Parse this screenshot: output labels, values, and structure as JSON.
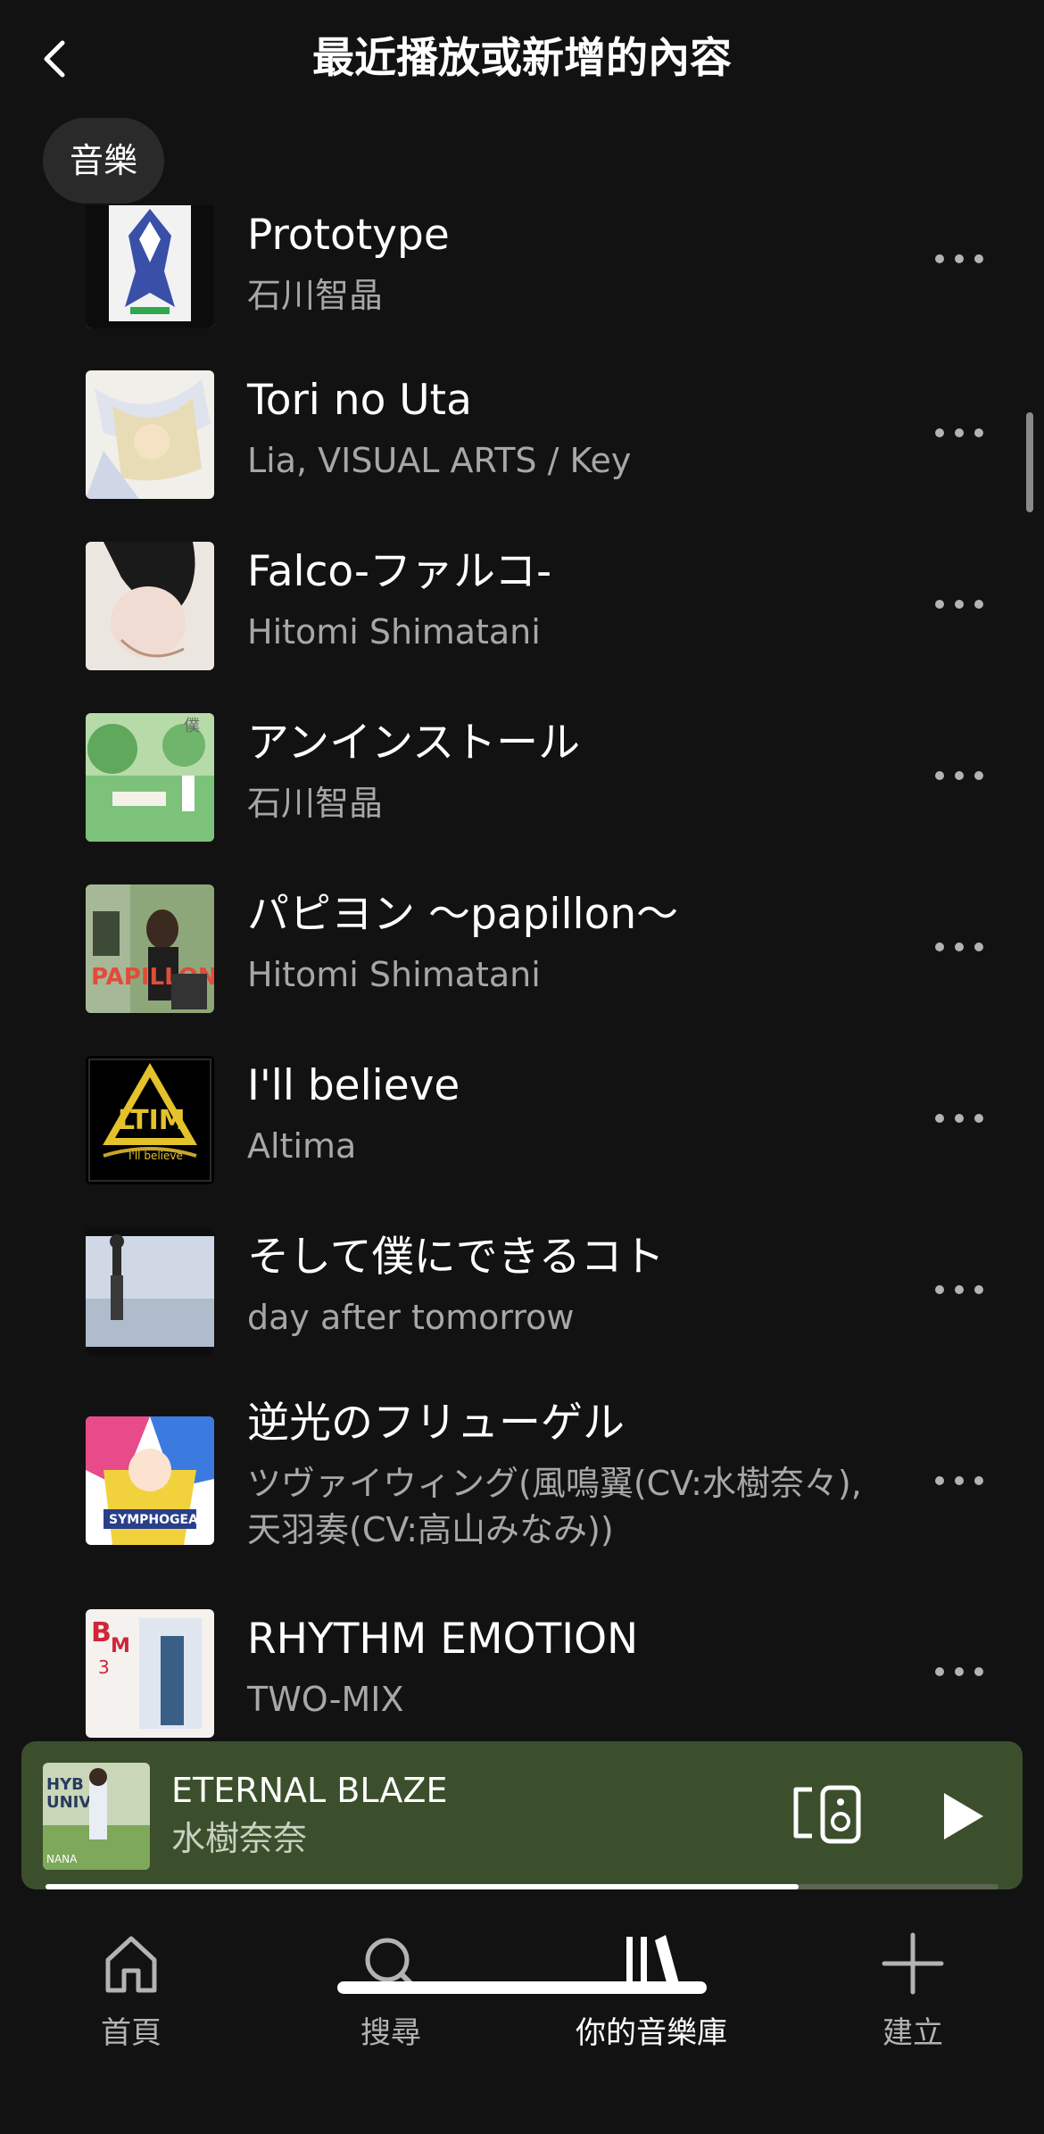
{
  "header": {
    "title": "最近播放或新增的內容",
    "back_icon": "chevron-left-icon"
  },
  "filter_chip": {
    "label": "音樂"
  },
  "tracks": [
    {
      "title": "Prototype",
      "artist": "石川智晶"
    },
    {
      "title": "Tori no Uta",
      "artist": "Lia, VISUAL ARTS / Key"
    },
    {
      "title": "Falco-ファルコ-",
      "artist": "Hitomi Shimatani"
    },
    {
      "title": "アンインストール",
      "artist": "石川智晶"
    },
    {
      "title": "パピヨン 〜papillon〜",
      "artist": "Hitomi Shimatani"
    },
    {
      "title": "I'll believe",
      "artist": "Altima"
    },
    {
      "title": "そして僕にできるコト",
      "artist": "day after tomorrow"
    },
    {
      "title": "逆光のフリューゲル",
      "artist": "ツヴァイウィング(風鳴翼(CV:水樹奈々),",
      "artist_line2": "天羽奏(CV:高山みなみ))"
    },
    {
      "title": "RHYTHM EMOTION",
      "artist": "TWO-MIX"
    }
  ],
  "now_playing": {
    "title": "ETERNAL BLAZE",
    "artist": "水樹奈奈",
    "progress": 0.79,
    "background_color": "#3b4f2c"
  },
  "tabs": [
    {
      "label": "首頁",
      "icon": "home-icon",
      "active": false
    },
    {
      "label": "搜尋",
      "icon": "search-icon",
      "active": false
    },
    {
      "label": "你的音樂庫",
      "icon": "library-icon",
      "active": true
    },
    {
      "label": "建立",
      "icon": "plus-icon",
      "active": false
    }
  ],
  "colors": {
    "background": "#121212",
    "text_primary": "#ffffff",
    "text_secondary": "#a7a7a7"
  }
}
